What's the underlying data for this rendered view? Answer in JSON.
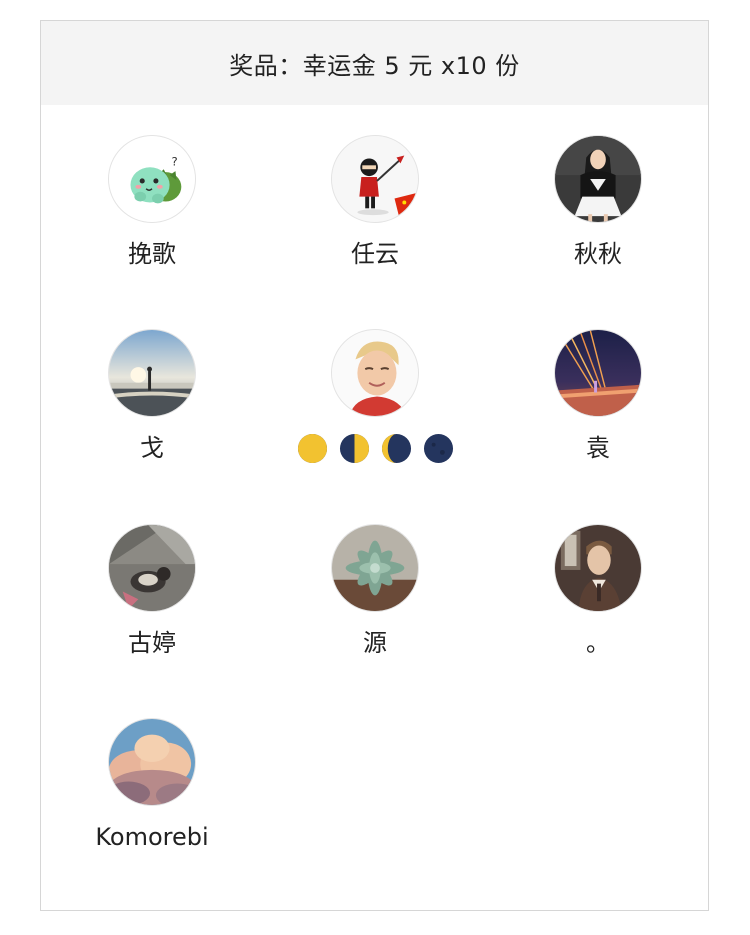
{
  "header": {
    "prize_text": "奖品：幸运金 5 元 x10 份"
  },
  "winners": [
    {
      "name": "挽歌",
      "avatar": "cartoon-dinosaur-avatar"
    },
    {
      "name": "任云",
      "avatar": "ninja-flag-avatar"
    },
    {
      "name": "秋秋",
      "avatar": "woman-portrait-avatar"
    },
    {
      "name": "戈",
      "avatar": "beach-sunset-avatar"
    },
    {
      "name": "",
      "name_emoji": [
        "waxing-gibbous-moon",
        "first-quarter-moon",
        "waning-crescent-moon",
        "new-moon"
      ],
      "avatar": "child-portrait-avatar"
    },
    {
      "name": "袁",
      "avatar": "bridge-night-avatar"
    },
    {
      "name": "古婷",
      "avatar": "cat-street-avatar"
    },
    {
      "name": "源",
      "avatar": "succulent-avatar"
    },
    {
      "name": "。",
      "avatar": "man-portrait-avatar"
    },
    {
      "name": "Komorebi",
      "avatar": "clouds-painting-avatar"
    }
  ],
  "colors": {
    "header_bg": "#f4f4f4",
    "card_border": "#d6d6d6",
    "text": "#222222",
    "moon_yellow": "#f2c230",
    "moon_dark": "#24355e"
  }
}
